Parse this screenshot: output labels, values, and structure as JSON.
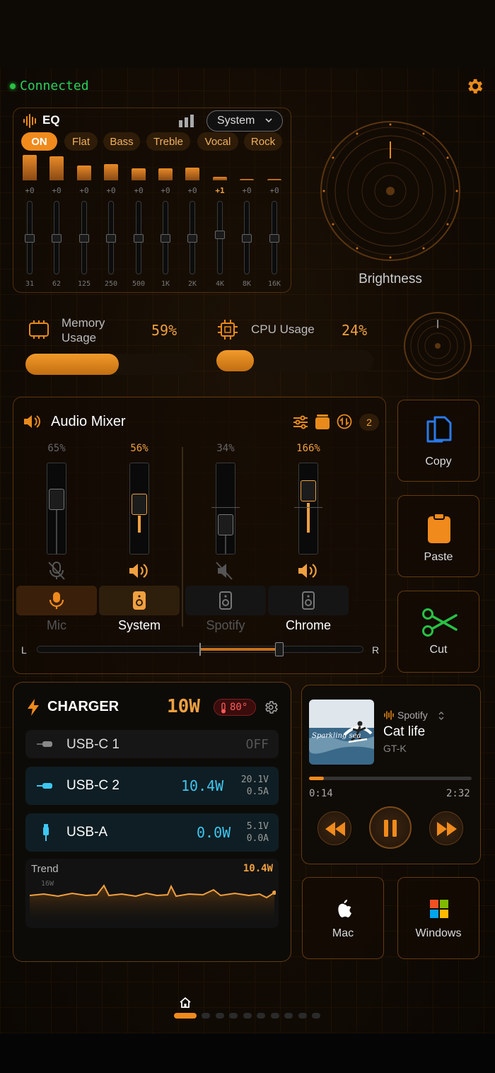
{
  "status": {
    "text": "Connected",
    "color": "#2ad15a"
  },
  "eq": {
    "title": "EQ",
    "output_select": "System",
    "presets": [
      "ON",
      "Flat",
      "Bass",
      "Treble",
      "Vocal",
      "Rock"
    ],
    "bands": [
      {
        "freq": "31",
        "value": "+0"
      },
      {
        "freq": "62",
        "value": "+0"
      },
      {
        "freq": "125",
        "value": "+0"
      },
      {
        "freq": "250",
        "value": "+0"
      },
      {
        "freq": "500",
        "value": "+0"
      },
      {
        "freq": "1K",
        "value": "+0"
      },
      {
        "freq": "2K",
        "value": "+0"
      },
      {
        "freq": "4K",
        "value": "+1"
      },
      {
        "freq": "8K",
        "value": "+0"
      },
      {
        "freq": "16K",
        "value": "+0"
      }
    ]
  },
  "brightness": {
    "label": "Brightness"
  },
  "memory": {
    "label": "Memory\nUsage",
    "value": "59%",
    "fraction": 0.59
  },
  "cpu": {
    "label": "CPU Usage",
    "value": "24%",
    "fraction": 0.24
  },
  "mixer": {
    "title": "Audio Mixer",
    "badge": "2",
    "left_label": "L",
    "right_label": "R",
    "channels": [
      {
        "name": "Mic",
        "percent": "65%",
        "muted": true
      },
      {
        "name": "System",
        "percent": "56%",
        "muted": false
      },
      {
        "name": "Spotify",
        "percent": "34%",
        "muted": true
      },
      {
        "name": "Chrome",
        "percent": "166%",
        "muted": false
      }
    ]
  },
  "actions": {
    "copy": "Copy",
    "paste": "Paste",
    "cut": "Cut",
    "mac": "Mac",
    "windows": "Windows"
  },
  "charger": {
    "title": "CHARGER",
    "total": "10W",
    "temp": "80°",
    "ports": [
      {
        "name": "USB-C 1",
        "watt": "OFF",
        "volt": "",
        "amp": ""
      },
      {
        "name": "USB-C 2",
        "watt": "10.4W",
        "volt": "20.1V",
        "amp": "0.5A"
      },
      {
        "name": "USB-A",
        "watt": "0.0W",
        "volt": "5.1V",
        "amp": "0.0A"
      }
    ],
    "trend": {
      "label": "Trend",
      "current": "10.4W",
      "scale_label": "16W"
    }
  },
  "player": {
    "source": "Spotify",
    "track": "Cat life",
    "artist": "GT-K",
    "elapsed": "0:14",
    "duration": "2:32",
    "progress": 0.09,
    "cover_text": "Sparkling sea"
  },
  "colors": {
    "accent": "#f08a1c",
    "cyan": "#3ec6f0",
    "green": "#28c244"
  }
}
